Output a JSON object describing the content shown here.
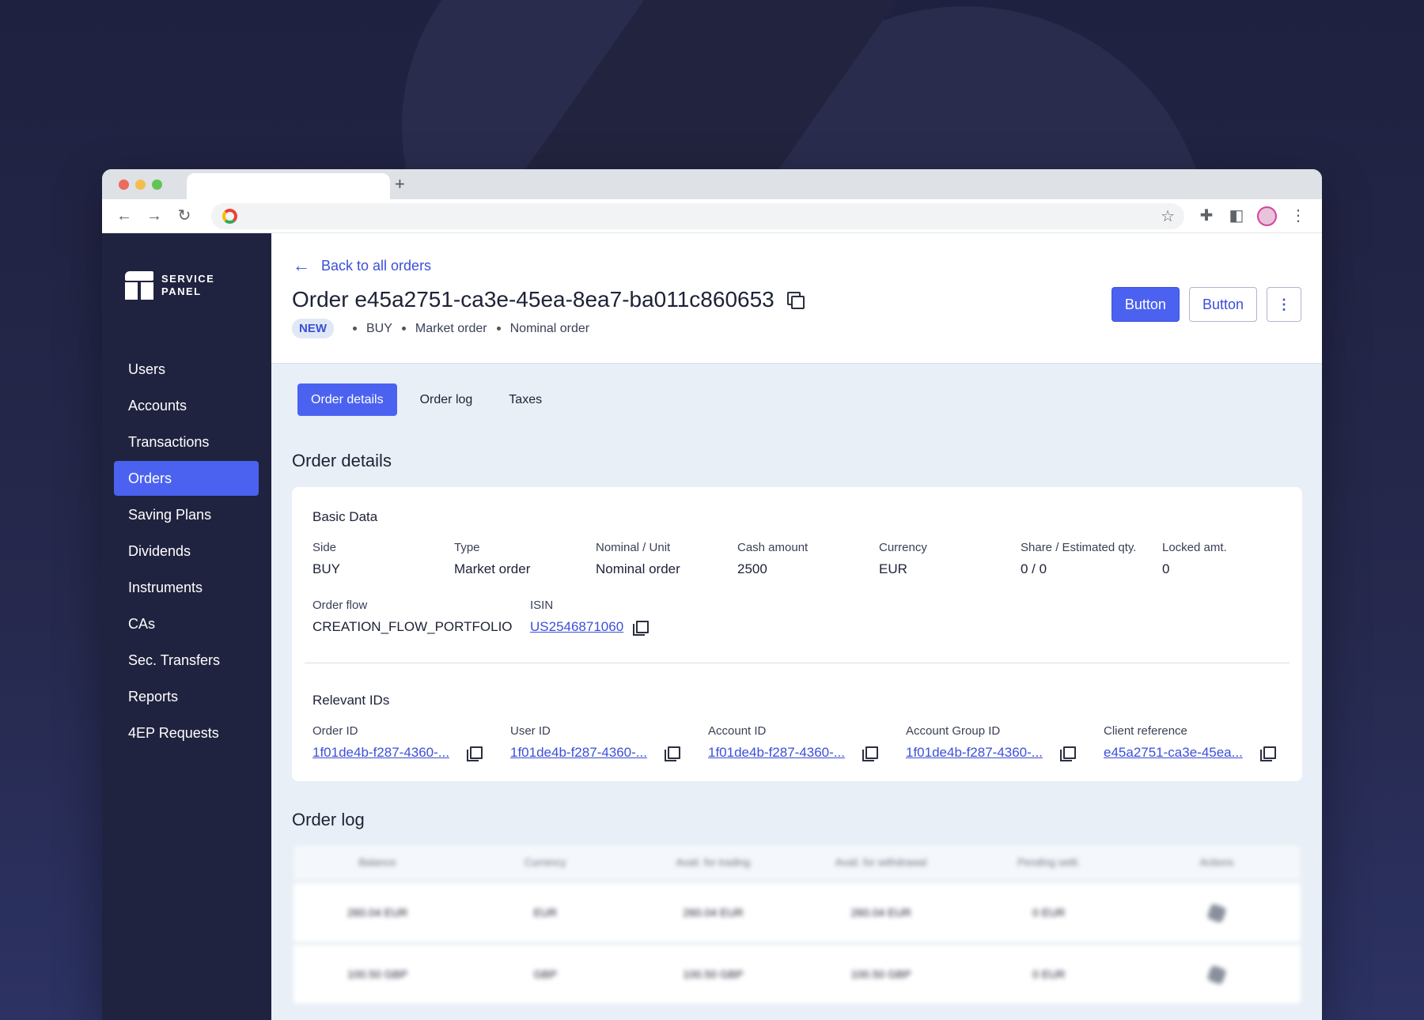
{
  "browser": {
    "new_tab_label": "+"
  },
  "brand": {
    "line1": "SERVICE",
    "line2": "PANEL"
  },
  "sidebar": {
    "items": [
      {
        "label": "Users"
      },
      {
        "label": "Accounts"
      },
      {
        "label": "Transactions"
      },
      {
        "label": "Orders",
        "active": true
      },
      {
        "label": "Saving Plans"
      },
      {
        "label": "Dividends"
      },
      {
        "label": "Instruments"
      },
      {
        "label": "CAs"
      },
      {
        "label": "Sec. Transfers"
      },
      {
        "label": "Reports"
      },
      {
        "label": "4EP Requests"
      }
    ]
  },
  "header": {
    "back_label": "Back to all orders",
    "title": "Order e45a2751-ca3e-45ea-8ea7-ba011c860653",
    "status_badge": "NEW",
    "meta": [
      "BUY",
      "Market order",
      "Nominal order"
    ],
    "primary_button": "Button",
    "secondary_button": "Button",
    "more_button": "⋮"
  },
  "tabs": [
    {
      "label": "Order details",
      "active": true
    },
    {
      "label": "Order log"
    },
    {
      "label": "Taxes"
    }
  ],
  "order_details": {
    "section_title": "Order details",
    "basic_data": {
      "heading": "Basic Data",
      "fields": [
        {
          "label": "Side",
          "value": "BUY"
        },
        {
          "label": "Type",
          "value": "Market order"
        },
        {
          "label": "Nominal / Unit",
          "value": "Nominal order"
        },
        {
          "label": "Cash amount",
          "value": "2500"
        },
        {
          "label": "Currency",
          "value": "EUR"
        },
        {
          "label": "Share / Estimated qty.",
          "value": "0 / 0"
        },
        {
          "label": "Locked amt.",
          "value": "0"
        }
      ],
      "order_flow": {
        "label": "Order flow",
        "value": "CREATION_FLOW_PORTFOLIO"
      },
      "isin": {
        "label": "ISIN",
        "value": "US2546871060"
      }
    },
    "relevant_ids": {
      "heading": "Relevant IDs",
      "fields": [
        {
          "label": "Order ID",
          "value": "1f01de4b-f287-4360-..."
        },
        {
          "label": "User ID",
          "value": "1f01de4b-f287-4360-..."
        },
        {
          "label": "Account ID",
          "value": "1f01de4b-f287-4360-..."
        },
        {
          "label": "Account Group ID",
          "value": "1f01de4b-f287-4360-..."
        },
        {
          "label": "Client reference",
          "value": "e45a2751-ca3e-45ea..."
        }
      ]
    }
  },
  "order_log": {
    "section_title": "Order log",
    "columns": [
      "Balance",
      "Currency",
      "Avail. for trading",
      "Avail. for withdrawal",
      "Pending settl.",
      "Actions"
    ],
    "rows": [
      [
        "260.04 EUR",
        "EUR",
        "260.04 EUR",
        "260.04 EUR",
        "0 EUR"
      ],
      [
        "100.50 GBP",
        "GBP",
        "100.50 GBP",
        "100.50 GBP",
        "0 EUR"
      ]
    ]
  },
  "colors": {
    "accent": "#4b62f0",
    "sidebar_bg": "#20233f",
    "link": "#3b4fd8",
    "content_bg": "#e8eff6"
  }
}
